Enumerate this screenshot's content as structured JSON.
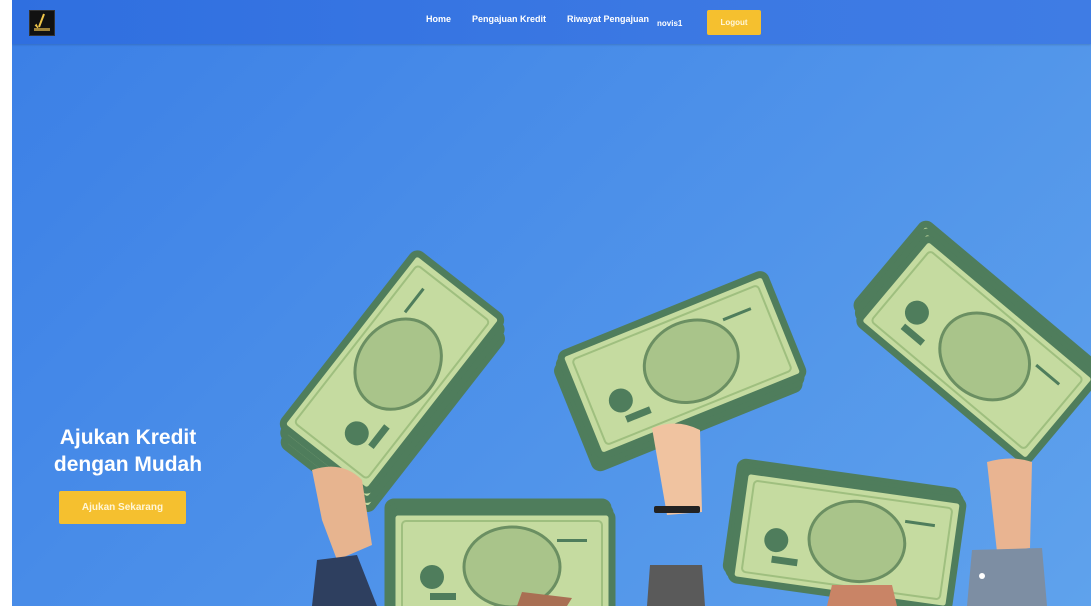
{
  "header": {
    "logo_icon": "brand-logo-icon",
    "nav": [
      {
        "label": "Home"
      },
      {
        "label": "Pengajuan Kredit"
      },
      {
        "label": "Riwayat Pengajuan"
      }
    ],
    "username": "novis1",
    "logout_label": "Logout"
  },
  "hero": {
    "title_line1": "Ajukan Kredit",
    "title_line2": "dengan Mudah",
    "cta_label": "Ajukan Sekarang",
    "illustration_icon": "hands-holding-money-icon"
  },
  "colors": {
    "navbar": "#3b78e3",
    "hero_bg": "#4b8fe9",
    "accent": "#f5c02f",
    "bill_light": "#c5dba0",
    "bill_dark": "#4f7d5c"
  }
}
